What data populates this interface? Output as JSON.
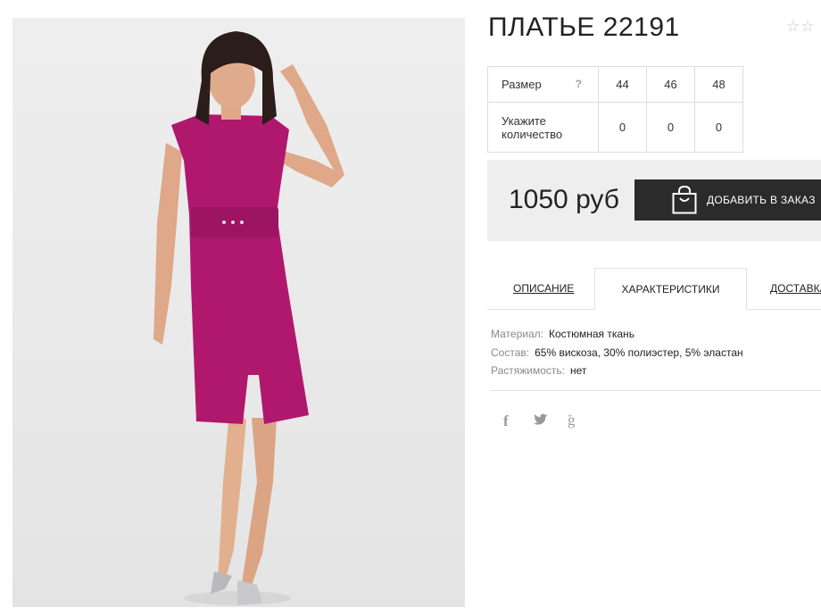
{
  "product": {
    "title": "ПЛАТЬЕ 22191",
    "rating_stars": "☆☆",
    "image_alt": "purple-dress-photo"
  },
  "sizes": {
    "row_label": "Размер",
    "help": "?",
    "values": [
      "44",
      "46",
      "48"
    ],
    "qty_label": "Укажите количество",
    "quantities": [
      "0",
      "0",
      "0"
    ]
  },
  "purchase": {
    "price": "1050 руб",
    "button_label": "ДОБАВИТЬ В ЗАКАЗ"
  },
  "tabs": [
    "ОПИСАНИЕ",
    "ХАРАКТЕРИСТИКИ",
    "ДОСТАВКА"
  ],
  "specs": [
    {
      "label": "Материал:",
      "value": "Костюмная ткань"
    },
    {
      "label": "Состав:",
      "value": "65% вискоза, 30% полиэстер, 5% эластан"
    },
    {
      "label": "Растяжимость:",
      "value": "нет"
    }
  ],
  "social": {
    "facebook": "f",
    "googleplus": "g"
  },
  "colors": {
    "dress": "#b0186e",
    "button": "#2b2b2b",
    "price_box": "#eeeeee"
  }
}
